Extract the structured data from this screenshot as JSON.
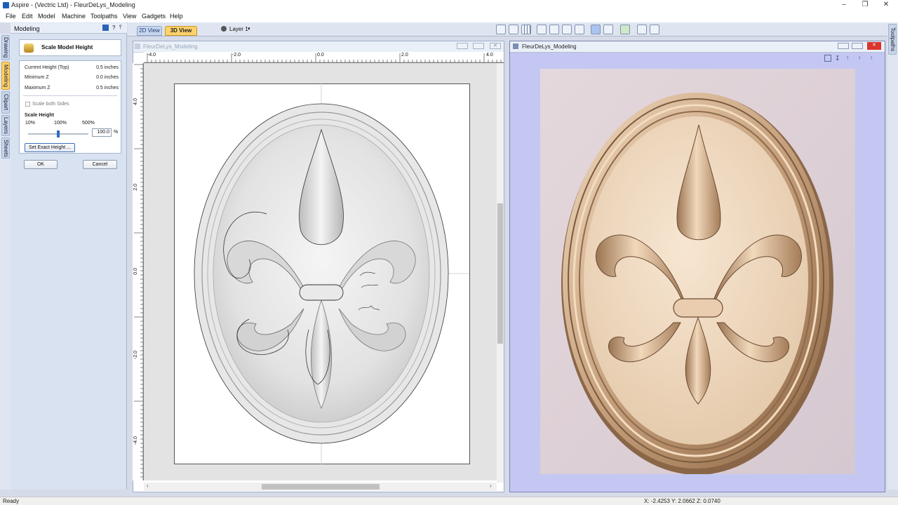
{
  "window": {
    "title": "Aspire - (Vectric Ltd) - FleurDeLys_Modeling"
  },
  "menu": [
    "File",
    "Edit",
    "Model",
    "Machine",
    "Toolpaths",
    "View",
    "Gadgets",
    "Help"
  ],
  "left_panel": {
    "header": "Modeling",
    "header_icons": [
      "?",
      "⫯"
    ],
    "vertical_tabs": [
      "Drawing",
      "Modeling",
      "Clipart",
      "Layers",
      "Sheets"
    ],
    "form": {
      "title": "Scale Model Height",
      "current_height_label": "Current Height (Top)",
      "current_height_value": "0.5 inches",
      "min_z_label": "Minimum Z",
      "min_z_value": "0.0 inches",
      "max_z_label": "Maximum Z",
      "max_z_value": "0.5 inches",
      "scale_both_sides": "Scale both Sides",
      "scale_height_label": "Scale Height",
      "slider_ticks": [
        "10%",
        "100%",
        "500%"
      ],
      "slider_value": "100.0",
      "percent": "%",
      "exact_height_button": "Set Exact Height ...",
      "ok": "OK",
      "cancel": "Cancel"
    }
  },
  "toolbar": {
    "tab_2d": "2D View",
    "tab_3d": "3D View",
    "layer": "Layer 1"
  },
  "view2d": {
    "title": "FleurDeLys_Modeling",
    "ruler_top": [
      "-4.0",
      "-2.0",
      "0.0",
      "2.0",
      "4.0"
    ],
    "ruler_left": [
      "4.0",
      "2.0",
      "0.0",
      "-2.0",
      "-4.0"
    ]
  },
  "view3d": {
    "title": "FleurDeLys_Modeling"
  },
  "right_tab": "Toolpaths",
  "status": {
    "left": "Ready",
    "coords": "X: -2.4253 Y: 2.0662 Z: 0.0740"
  }
}
